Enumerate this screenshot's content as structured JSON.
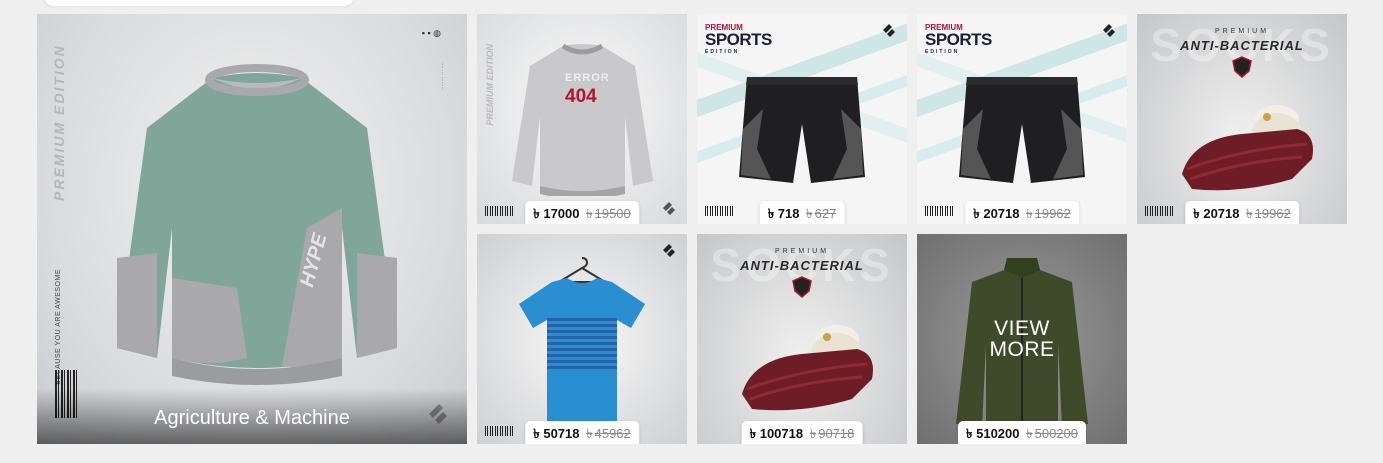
{
  "currency": "৳",
  "hero": {
    "caption": "Agriculture & Machine",
    "edition_text": "PREMIUM EDITION",
    "side_note": "BECAUSE YOU ARE AWESOME",
    "chest_text": "HYPE"
  },
  "products": [
    {
      "price": "17000",
      "old_price": "19500",
      "graphic_top": "ERROR",
      "graphic_main": "404"
    },
    {
      "price": "718",
      "old_price": "627",
      "logo_pre": "PREMIUM",
      "logo_main": "SPORTS",
      "logo_sub": "EDITION"
    },
    {
      "price": "20718",
      "old_price": "19962",
      "logo_pre": "PREMIUM",
      "logo_main": "SPORTS",
      "logo_sub": "EDITION"
    },
    {
      "price": "20718",
      "old_price": "19962",
      "title_pre": "PREMIUM",
      "title_main": "ANTI-BACTERIAL",
      "title_bg": "SOCKS"
    },
    {
      "price": "50718",
      "old_price": "45962"
    },
    {
      "price": "100718",
      "old_price": "90718",
      "title_pre": "PREMIUM",
      "title_main": "ANTI-BACTERIAL",
      "title_bg": "SOCKS"
    },
    {
      "price": "510200",
      "old_price": "500200",
      "overlay_line1": "VIEW",
      "overlay_line2": "MORE"
    }
  ],
  "colors": {
    "sweatshirt_green": "#7fa698",
    "sweatshirt_gray": "#a9a9ab",
    "shorts_black": "#1f1f21",
    "shoe_maroon": "#6e1d26",
    "tshirt_blue": "#2a8fd0",
    "jacket_olive": "#3f4a2a",
    "error_red": "#b3123a"
  }
}
